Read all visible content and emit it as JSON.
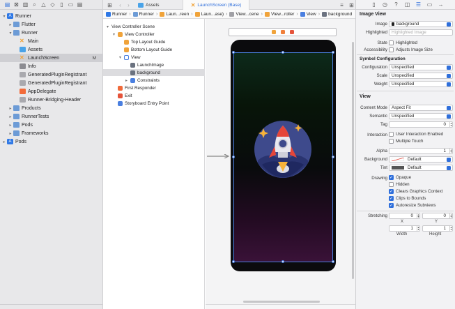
{
  "navigator": {
    "tree": [
      {
        "label": "Runner",
        "icon": "project-icon",
        "depth": 0,
        "expanded": true
      },
      {
        "label": "Flutter",
        "icon": "folder-icon",
        "depth": 1,
        "expanded": false
      },
      {
        "label": "Runner",
        "icon": "folder-icon",
        "depth": 1,
        "expanded": true
      },
      {
        "label": "Main",
        "icon": "storyboard-icon",
        "depth": 2
      },
      {
        "label": "Assets",
        "icon": "assets-icon",
        "depth": 2
      },
      {
        "label": "LaunchScreen",
        "icon": "storyboard-icon",
        "depth": 2,
        "selected": true,
        "badge": "M"
      },
      {
        "label": "Info",
        "icon": "plist-icon",
        "depth": 2
      },
      {
        "label": "GeneratedPluginRegistrant",
        "icon": "header-icon",
        "depth": 2
      },
      {
        "label": "GeneratedPluginRegistrant",
        "icon": "objc-icon",
        "depth": 2
      },
      {
        "label": "AppDelegate",
        "icon": "swift-icon",
        "depth": 2
      },
      {
        "label": "Runner-Bridging-Header",
        "icon": "header-icon",
        "depth": 2
      },
      {
        "label": "Products",
        "icon": "folder-icon",
        "depth": 1,
        "expanded": false
      },
      {
        "label": "RunnerTests",
        "icon": "folder-icon",
        "depth": 1,
        "expanded": false
      },
      {
        "label": "Pods",
        "icon": "folder-icon",
        "depth": 1,
        "expanded": false
      },
      {
        "label": "Frameworks",
        "icon": "folder-icon",
        "depth": 1,
        "expanded": false
      },
      {
        "label": "Pods",
        "icon": "project-icon",
        "depth": 0,
        "expanded": false
      }
    ]
  },
  "tabs": [
    {
      "label": "Assets",
      "active": false
    },
    {
      "label": "LaunchScreen (Base)",
      "active": true
    }
  ],
  "breadcrumbs": [
    "Runner",
    "Runner",
    "Laun...reen",
    "Laun...ase)",
    "View...cene",
    "View...roller",
    "View",
    "background"
  ],
  "outline": [
    {
      "label": "View Controller Scene",
      "depth": 0,
      "icon": "scene-icon",
      "color": "#a0a0a5"
    },
    {
      "label": "View Controller",
      "depth": 1,
      "icon": "view-controller-icon",
      "color": "#f0a33a"
    },
    {
      "label": "Top Layout Guide",
      "depth": 2,
      "icon": "layout-guide-icon",
      "color": "#f0a33a"
    },
    {
      "label": "Bottom Layout Guide",
      "depth": 2,
      "icon": "layout-guide-icon",
      "color": "#f0a33a"
    },
    {
      "label": "View",
      "depth": 2,
      "icon": "view-icon",
      "color": "#4a7fe0"
    },
    {
      "label": "LaunchImage",
      "depth": 3,
      "icon": "image-view-icon",
      "color": "#6b7280"
    },
    {
      "label": "background",
      "depth": 3,
      "icon": "image-view-icon",
      "color": "#6b7280",
      "selected": true
    },
    {
      "label": "Constraints",
      "depth": 3,
      "icon": "constraints-icon",
      "color": "#4a7fe0"
    },
    {
      "label": "First Responder",
      "depth": 1,
      "icon": "first-responder-icon",
      "color": "#f06a3a"
    },
    {
      "label": "Exit",
      "depth": 1,
      "icon": "exit-icon",
      "color": "#e5533a"
    },
    {
      "label": "Storyboard Entry Point",
      "depth": 1,
      "icon": "entry-point-icon",
      "color": "#4a7fe0"
    }
  ],
  "inspector": {
    "image_view_title": "Image View",
    "image_label": "Image",
    "image_value": "background",
    "highlighted_label": "Highlighted",
    "highlighted_placeholder": "Highlighted Image",
    "state_label": "State",
    "state_check": "Highlighted",
    "accessibility_label": "Accessibility",
    "accessibility_check": "Adjusts Image Size",
    "symbol_title": "Symbol Configuration",
    "configuration_label": "Configuration",
    "configuration_value": "Unspecified",
    "scale_label": "Scale",
    "scale_value": "Unspecified",
    "weight_label": "Weight",
    "weight_value": "Unspecified",
    "view_title": "View",
    "content_mode_label": "Content Mode",
    "content_mode_value": "Aspect Fit",
    "semantic_label": "Semantic",
    "semantic_value": "Unspecified",
    "tag_label": "Tag",
    "tag_value": "0",
    "interaction_label": "Interaction",
    "interaction_check1": "User Interaction Enabled",
    "interaction_check2": "Multiple Touch",
    "alpha_label": "Alpha",
    "alpha_value": "1",
    "background_label": "Background",
    "background_value": "Default",
    "tint_label": "Tint",
    "tint_value": "Default",
    "drawing_label": "Drawing",
    "drawing_opaque": "Opaque",
    "drawing_hidden": "Hidden",
    "drawing_clears": "Clears Graphics Context",
    "drawing_clips": "Clips to Bounds",
    "drawing_autoresize": "Autoresize Subviews",
    "stretching_label": "Stretching",
    "stretch_x": "0",
    "stretch_y": "0",
    "stretch_w": "1",
    "stretch_h": "1",
    "x_label": "X",
    "y_label": "Y",
    "width_label": "Width",
    "height_label": "Height"
  },
  "colors": {
    "accent": "#2f6fdb",
    "selection": "#4a7fe0"
  }
}
